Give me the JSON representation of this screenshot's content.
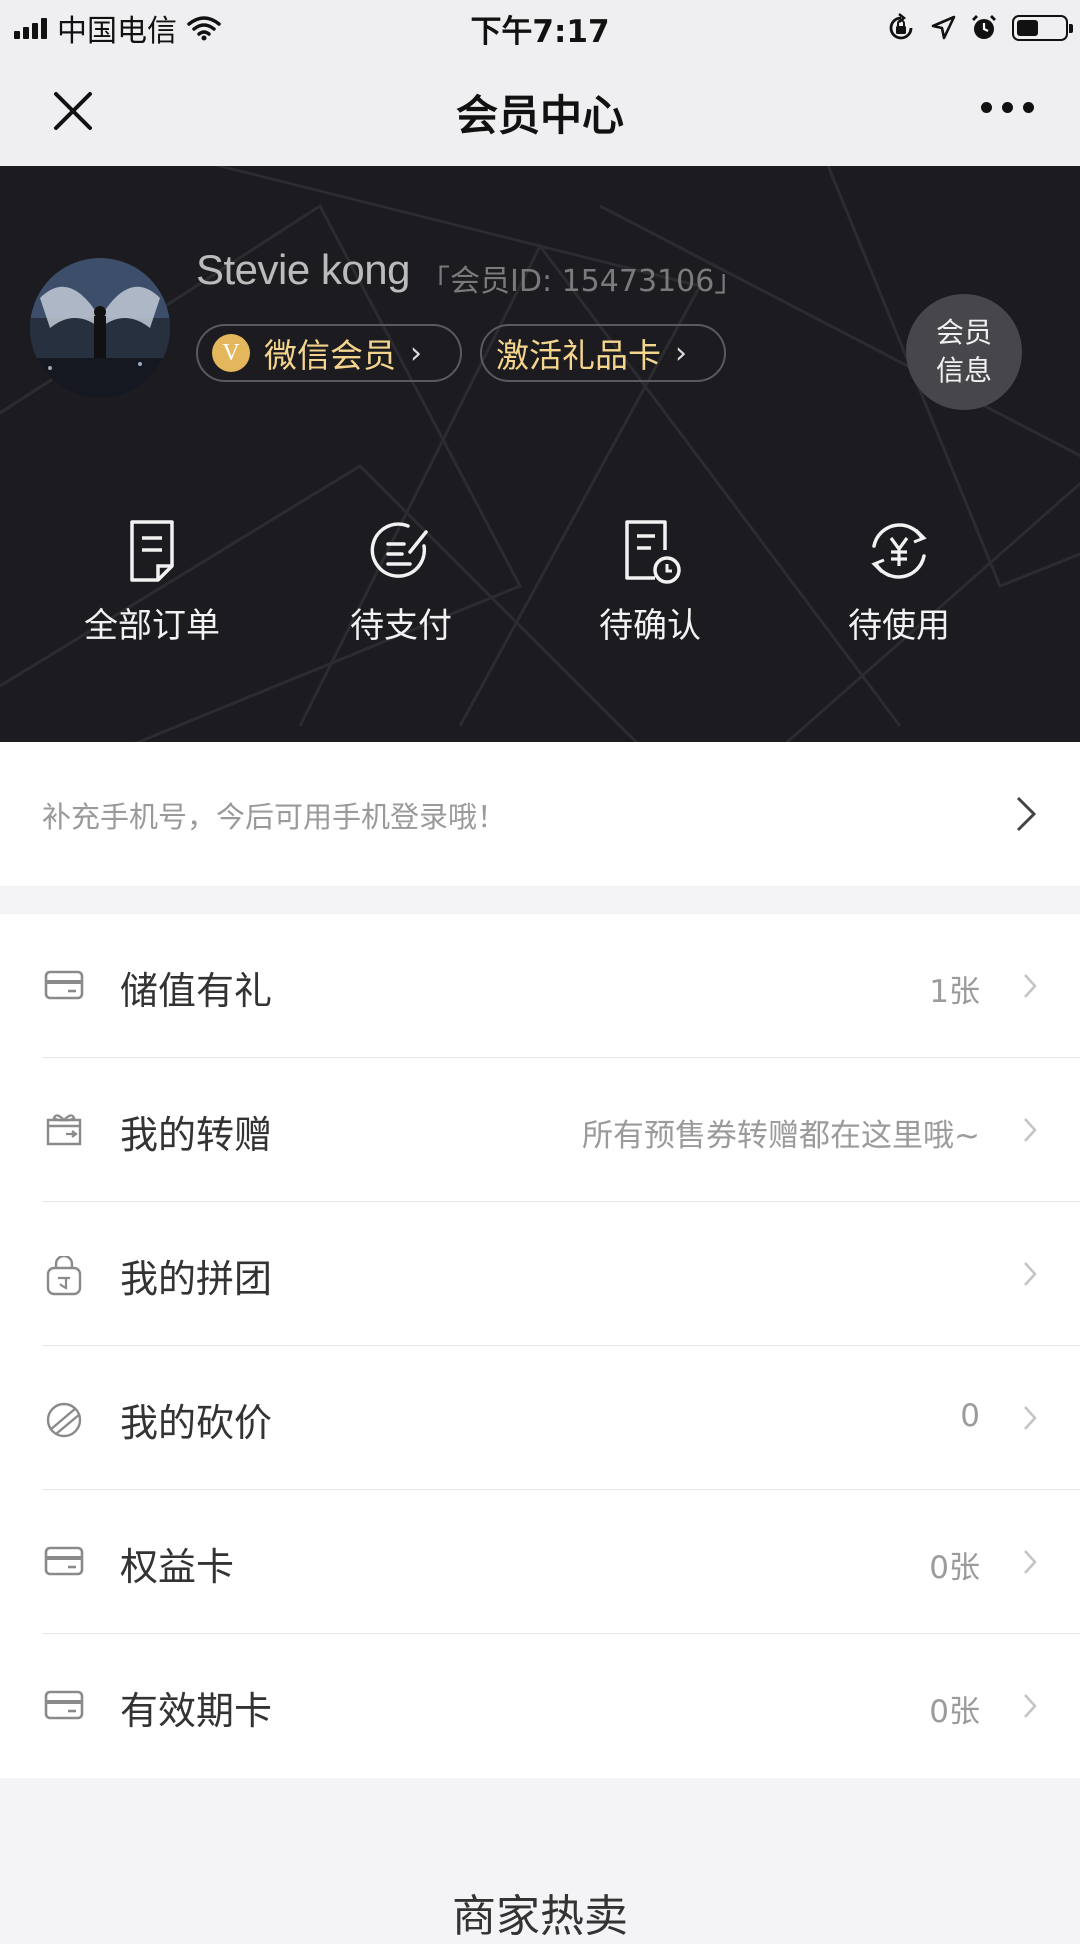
{
  "status_bar": {
    "carrier": "中国电信",
    "time": "下午7:17",
    "battery_level": 0.45
  },
  "nav": {
    "title": "会员中心"
  },
  "profile": {
    "name": "Stevie kong",
    "member_id": "「会员ID: 15473106」",
    "badge_wechat": "微信会员",
    "badge_wechat_letter": "V",
    "badge_giftcard": "激活礼品卡",
    "member_info_line1": "会员",
    "member_info_line2": "信息"
  },
  "orders": [
    {
      "label": "全部订单",
      "icon": "order-list-icon"
    },
    {
      "label": "待支付",
      "icon": "pay-pending-icon"
    },
    {
      "label": "待确认",
      "icon": "confirm-pending-icon"
    },
    {
      "label": "待使用",
      "icon": "yen-refresh-icon"
    }
  ],
  "phone_tip": "补充手机号，今后可用手机登录哦！",
  "menu": [
    {
      "label": "储值有礼",
      "value": "1张",
      "icon": "card-icon"
    },
    {
      "label": "我的转赠",
      "value": "所有预售券转赠都在这里哦~",
      "icon": "gift-icon"
    },
    {
      "label": "我的拼团",
      "value": "",
      "icon": "group-bag-icon"
    },
    {
      "label": "我的砍价",
      "value": "0",
      "icon": "bargain-icon"
    },
    {
      "label": "权益卡",
      "value": "0张",
      "icon": "card-icon"
    },
    {
      "label": "有效期卡",
      "value": "0张",
      "icon": "card-icon"
    }
  ],
  "section_title": "商家热卖",
  "colors": {
    "hero_bg": "#1c1b1f",
    "badge_text": "#f4d58d",
    "v_badge": "#e5b75c"
  }
}
